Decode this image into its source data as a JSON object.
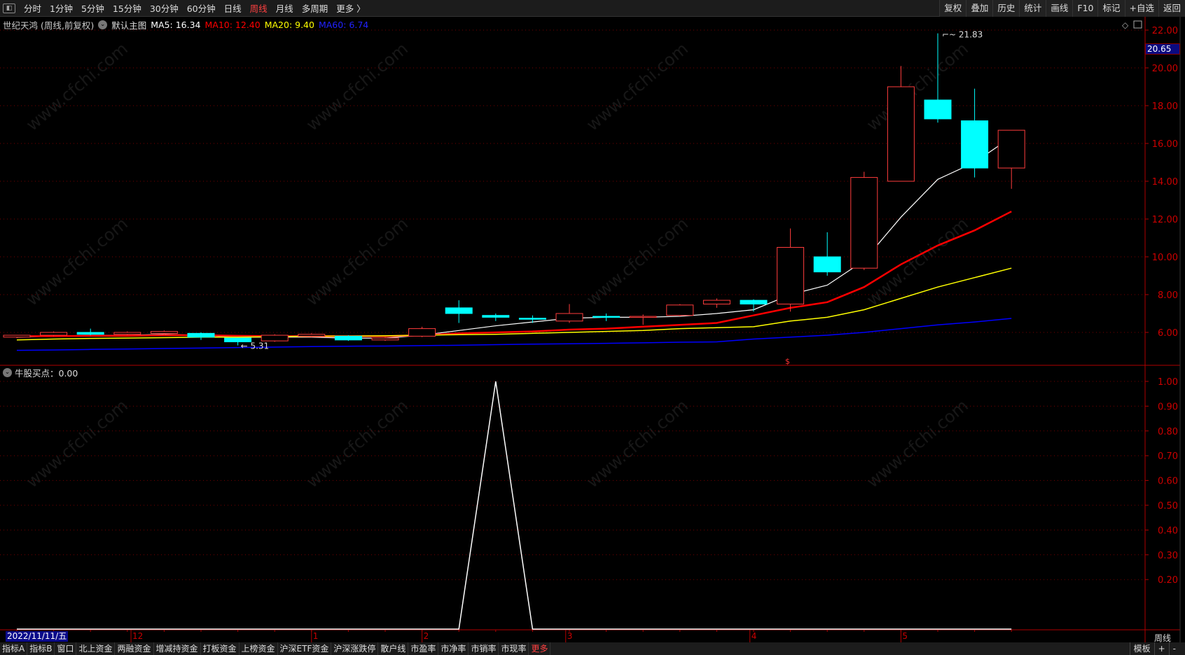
{
  "toolbar": {
    "periods": [
      "分时",
      "1分钟",
      "5分钟",
      "15分钟",
      "30分钟",
      "60分钟",
      "日线",
      "周线",
      "月线",
      "多周期",
      "更多 〉"
    ],
    "active_period": "周线",
    "right_buttons": [
      "复权",
      "叠加",
      "历史",
      "统计",
      "画线",
      "F10",
      "标记",
      "+自选",
      "返回"
    ]
  },
  "header": {
    "stock": "世纪天鸿 (周线,前复权)",
    "main_chart": "默认主图",
    "ma5": "MA5: 16.34",
    "ma10": "MA10: 12.40",
    "ma20": "MA20: 9.40",
    "ma60": "MA60: 6.74"
  },
  "current_price": "20.65",
  "indicator": {
    "title": "牛股买点：0.00"
  },
  "date_axis": {
    "current": "2022/11/11/五",
    "months": [
      {
        "label": "12",
        "index": 3.1
      },
      {
        "label": "1",
        "index": 8.0
      },
      {
        "label": "2",
        "index": 11.0
      },
      {
        "label": "3",
        "index": 14.9
      },
      {
        "label": "4",
        "index": 19.9
      },
      {
        "label": "5",
        "index": 24.0
      }
    ]
  },
  "period_label": "周线",
  "bottom_tabs": [
    "指标A",
    "指标B",
    "窗口",
    "北上资金",
    "两融资金",
    "增减持资金",
    "打板资金",
    "上榜资金",
    "沪深ETF资金",
    "沪深涨跌停",
    "散户线",
    "市盈率",
    "市净率",
    "市销率",
    "市现率",
    "更多"
  ],
  "bottom_right": [
    "模板",
    "+",
    "-"
  ],
  "watermark": "www.cfchi.com",
  "colors": {
    "up": "#ff3c3c",
    "down": "#00ffff",
    "ma5": "#ffffff",
    "ma10": "#ff0000",
    "ma20": "#ffff00",
    "ma60": "#0000ff",
    "axis": "#b00000"
  },
  "chart_data": [
    {
      "type": "candlestick",
      "title": "世纪天鸿 周线",
      "ylim": [
        4.3,
        22.5
      ],
      "yticks": [
        "22.00",
        "20.00",
        "18.00",
        "16.00",
        "14.00",
        "12.00",
        "10.00",
        "8.00",
        "6.00"
      ],
      "ytick_values": [
        22,
        20,
        18,
        16,
        14,
        12,
        10,
        8,
        6
      ],
      "annotations": [
        {
          "label": "21.83",
          "index": 25,
          "value": 21.83
        },
        {
          "label": "5.31",
          "index": 6,
          "value": 5.31
        }
      ],
      "ohlc": [
        [
          5.75,
          5.85,
          5.7,
          5.85
        ],
        [
          5.85,
          6.05,
          5.8,
          6.0
        ],
        [
          6.0,
          6.2,
          5.85,
          5.9
        ],
        [
          5.9,
          6.05,
          5.85,
          6.0
        ],
        [
          5.95,
          6.1,
          5.9,
          6.05
        ],
        [
          5.95,
          6.0,
          5.6,
          5.75
        ],
        [
          5.7,
          5.72,
          5.31,
          5.5
        ],
        [
          5.55,
          5.9,
          5.5,
          5.85
        ],
        [
          5.8,
          5.95,
          5.75,
          5.9
        ],
        [
          5.8,
          5.85,
          5.55,
          5.6
        ],
        [
          5.6,
          5.75,
          5.55,
          5.7
        ],
        [
          5.8,
          6.3,
          5.75,
          6.2
        ],
        [
          7.3,
          7.7,
          6.5,
          7.0
        ],
        [
          6.9,
          7.0,
          6.6,
          6.8
        ],
        [
          6.75,
          6.9,
          6.5,
          6.7
        ],
        [
          6.6,
          7.5,
          6.5,
          7.0
        ],
        [
          6.85,
          7.0,
          6.6,
          6.8
        ],
        [
          6.8,
          6.95,
          6.4,
          6.85
        ],
        [
          6.9,
          7.5,
          6.85,
          7.45
        ],
        [
          7.5,
          7.8,
          7.3,
          7.7
        ],
        [
          7.7,
          7.75,
          7.1,
          7.5
        ],
        [
          7.5,
          11.5,
          7.1,
          10.5
        ],
        [
          10.0,
          11.3,
          9.0,
          9.2
        ],
        [
          9.4,
          14.5,
          9.3,
          14.2
        ],
        [
          14.0,
          20.1,
          14.0,
          19.0
        ],
        [
          18.3,
          21.83,
          17.1,
          17.3
        ],
        [
          17.2,
          18.9,
          14.2,
          14.7
        ],
        [
          14.7,
          16.7,
          13.6,
          16.7
        ]
      ],
      "series": [
        {
          "name": "MA5",
          "values": [
            5.75,
            5.8,
            5.85,
            5.85,
            5.9,
            5.85,
            5.75,
            5.75,
            5.75,
            5.7,
            5.7,
            5.85,
            6.1,
            6.35,
            6.55,
            6.75,
            6.8,
            6.8,
            6.85,
            7.0,
            7.2,
            8.0,
            8.5,
            9.8,
            12.1,
            14.1,
            15.0,
            16.34
          ]
        },
        {
          "name": "MA10",
          "values": [
            5.8,
            5.8,
            5.82,
            5.82,
            5.85,
            5.85,
            5.82,
            5.8,
            5.8,
            5.8,
            5.8,
            5.85,
            5.95,
            6.0,
            6.05,
            6.15,
            6.2,
            6.3,
            6.4,
            6.5,
            6.9,
            7.3,
            7.6,
            8.4,
            9.6,
            10.6,
            11.4,
            12.4
          ]
        },
        {
          "name": "MA20",
          "values": [
            5.6,
            5.65,
            5.68,
            5.7,
            5.72,
            5.75,
            5.75,
            5.78,
            5.8,
            5.8,
            5.82,
            5.85,
            5.88,
            5.9,
            5.95,
            6.0,
            6.05,
            6.1,
            6.2,
            6.25,
            6.3,
            6.6,
            6.8,
            7.2,
            7.8,
            8.4,
            8.9,
            9.4
          ]
        },
        {
          "name": "MA60",
          "values": [
            5.05,
            5.07,
            5.1,
            5.12,
            5.15,
            5.17,
            5.2,
            5.22,
            5.25,
            5.27,
            5.28,
            5.3,
            5.32,
            5.35,
            5.38,
            5.4,
            5.42,
            5.45,
            5.48,
            5.5,
            5.65,
            5.75,
            5.85,
            6.0,
            6.2,
            6.4,
            6.55,
            6.74
          ]
        }
      ]
    },
    {
      "type": "line",
      "title": "牛股买点",
      "ylim": [
        0,
        1.0
      ],
      "yticks": [
        "1.00",
        "0.90",
        "0.80",
        "0.70",
        "0.60",
        "0.50",
        "0.40",
        "0.30",
        "0.20"
      ],
      "ytick_values": [
        1.0,
        0.9,
        0.8,
        0.7,
        0.6,
        0.5,
        0.4,
        0.3,
        0.2
      ],
      "values": [
        0,
        0,
        0,
        0,
        0,
        0,
        0,
        0,
        0,
        0,
        0,
        0,
        0,
        1,
        0,
        0,
        0,
        0,
        0,
        0,
        0,
        0,
        0,
        0,
        0,
        0,
        0,
        0
      ]
    }
  ]
}
